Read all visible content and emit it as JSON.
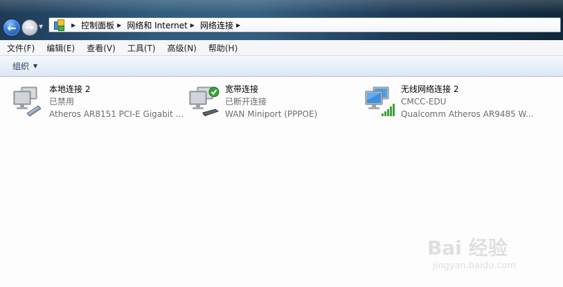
{
  "colors": {
    "accent": "#2f7ad6",
    "window_frame": "#2f5b7d",
    "status_ok": "#3aa23a"
  },
  "address": {
    "crumbs": [
      "控制面板",
      "网络和 Internet",
      "网络连接"
    ],
    "icon": "control-panel-icon"
  },
  "menu": [
    "文件(F)",
    "编辑(E)",
    "查看(V)",
    "工具(T)",
    "高级(N)",
    "帮助(H)"
  ],
  "toolbar": {
    "organize_label": "组织"
  },
  "connections": [
    {
      "name": "本地连接 2",
      "status": "已禁用",
      "device": "Atheros AR8151 PCI-E Gigabit ...",
      "icon": "ethernet-adapter-icon"
    },
    {
      "name": "宽带连接",
      "status": "已断开连接",
      "device": "WAN Miniport (PPPOE)",
      "icon": "broadband-connection-icon"
    },
    {
      "name": "无线网络连接 2",
      "status": "CMCC-EDU",
      "device": "Qualcomm Atheros AR9485 W...",
      "icon": "wireless-adapter-icon"
    }
  ],
  "watermark": {
    "logo": "Bai 经验",
    "url": "jingyan.baidu.com"
  }
}
